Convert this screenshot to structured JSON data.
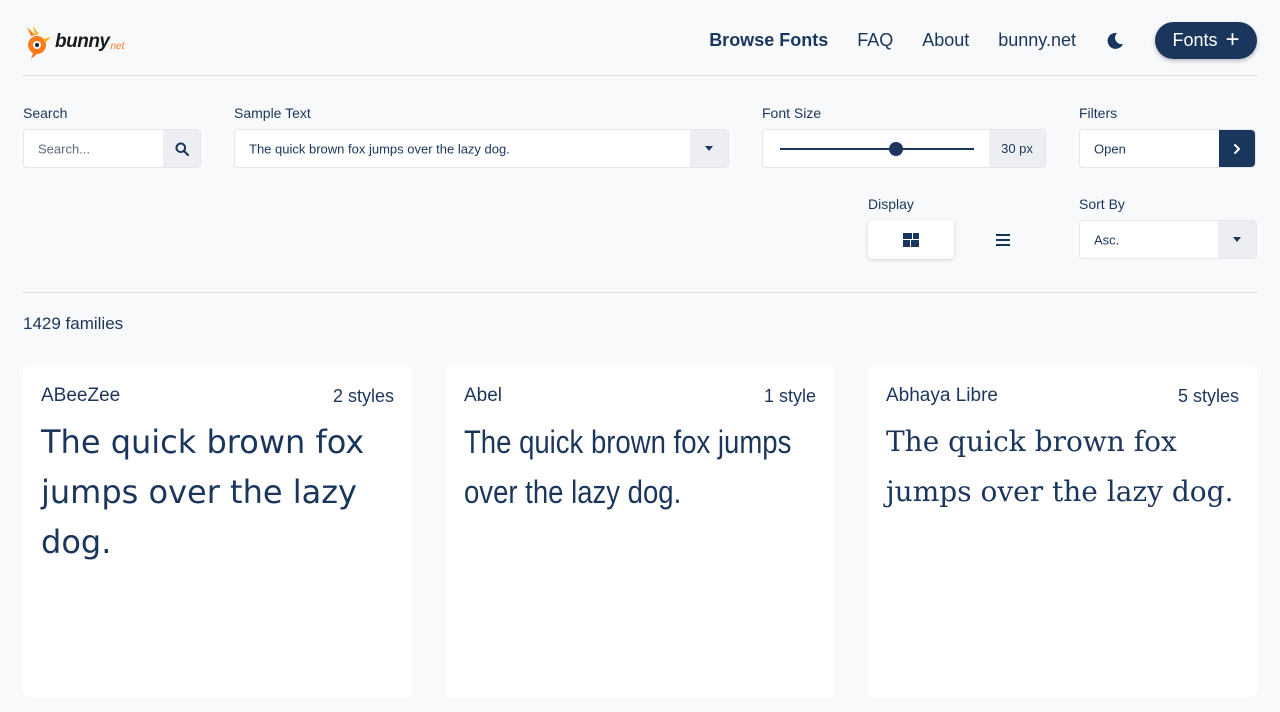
{
  "brand": {
    "name": "bunny",
    "suffix": "net",
    "accent": "#ff7a1a",
    "primary": "#1b365d"
  },
  "nav": {
    "items": [
      {
        "label": "Browse Fonts",
        "active": true
      },
      {
        "label": "FAQ",
        "active": false
      },
      {
        "label": "About",
        "active": false
      },
      {
        "label": "bunny.net",
        "active": false
      }
    ],
    "theme_icon": "moon-icon",
    "fonts_button": {
      "label": "Fonts",
      "icon": "plus-icon"
    }
  },
  "controls": {
    "search": {
      "label": "Search",
      "placeholder": "Search...",
      "icon": "search-icon"
    },
    "sample_text": {
      "label": "Sample Text",
      "value": "The quick brown fox jumps over the lazy dog."
    },
    "font_size": {
      "label": "Font Size",
      "value": 30,
      "unit_text": "30 px",
      "level": 0.6
    },
    "filters": {
      "label": "Filters",
      "value": "Open"
    },
    "display": {
      "label": "Display",
      "options": [
        "grid-icon",
        "list-icon"
      ],
      "active": "grid"
    },
    "sort_by": {
      "label": "Sort By",
      "value": "Asc."
    }
  },
  "results": {
    "count_text": "1429 families"
  },
  "cards": [
    {
      "name": "ABeeZee",
      "styles": "2 styles",
      "sample": "The quick brown fox jumps over the lazy dog."
    },
    {
      "name": "Abel",
      "styles": "1 style",
      "sample": "The quick brown fox jumps over the lazy dog."
    },
    {
      "name": "Abhaya Libre",
      "styles": "5 styles",
      "sample": "The quick brown fox jumps over the lazy dog."
    }
  ]
}
